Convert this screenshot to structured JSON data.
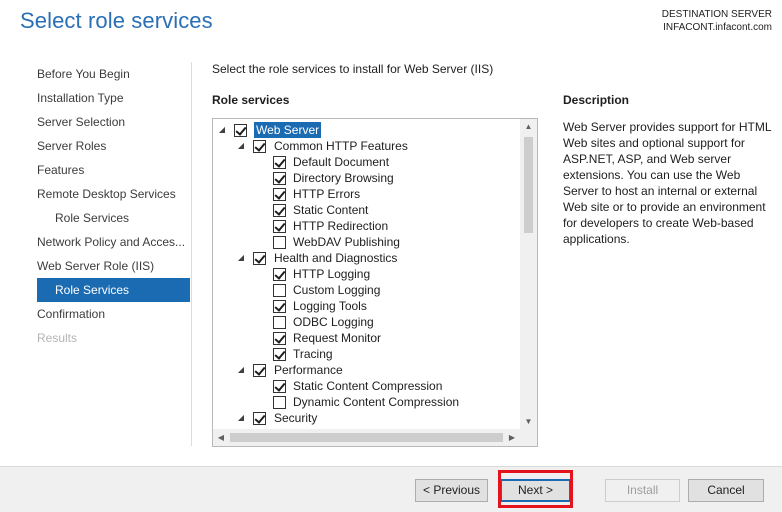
{
  "header": {
    "title": "Select role services",
    "destination_label": "DESTINATION SERVER",
    "destination_server": "INFACONT.infacont.com"
  },
  "nav": {
    "items": [
      {
        "label": "Before You Begin",
        "state": "normal",
        "indent": false
      },
      {
        "label": "Installation Type",
        "state": "normal",
        "indent": false
      },
      {
        "label": "Server Selection",
        "state": "normal",
        "indent": false
      },
      {
        "label": "Server Roles",
        "state": "normal",
        "indent": false
      },
      {
        "label": "Features",
        "state": "normal",
        "indent": false
      },
      {
        "label": "Remote Desktop Services",
        "state": "normal",
        "indent": false
      },
      {
        "label": "Role Services",
        "state": "normal",
        "indent": true
      },
      {
        "label": "Network Policy and Acces...",
        "state": "normal",
        "indent": false
      },
      {
        "label": "Web Server Role (IIS)",
        "state": "normal",
        "indent": false
      },
      {
        "label": "Role Services",
        "state": "selected",
        "indent": true
      },
      {
        "label": "Confirmation",
        "state": "normal",
        "indent": false
      },
      {
        "label": "Results",
        "state": "disabled",
        "indent": false
      }
    ]
  },
  "main": {
    "instruction": "Select the role services to install for Web Server (IIS)",
    "role_services_heading": "Role services",
    "tree": [
      {
        "label": "Web Server",
        "level": 0,
        "checked": true,
        "expander": true,
        "highlight": true
      },
      {
        "label": "Common HTTP Features",
        "level": 1,
        "checked": true,
        "expander": true
      },
      {
        "label": "Default Document",
        "level": 2,
        "checked": true
      },
      {
        "label": "Directory Browsing",
        "level": 2,
        "checked": true
      },
      {
        "label": "HTTP Errors",
        "level": 2,
        "checked": true
      },
      {
        "label": "Static Content",
        "level": 2,
        "checked": true
      },
      {
        "label": "HTTP Redirection",
        "level": 2,
        "checked": true
      },
      {
        "label": "WebDAV Publishing",
        "level": 2,
        "checked": false
      },
      {
        "label": "Health and Diagnostics",
        "level": 1,
        "checked": true,
        "expander": true
      },
      {
        "label": "HTTP Logging",
        "level": 2,
        "checked": true
      },
      {
        "label": "Custom Logging",
        "level": 2,
        "checked": false
      },
      {
        "label": "Logging Tools",
        "level": 2,
        "checked": true
      },
      {
        "label": "ODBC Logging",
        "level": 2,
        "checked": false
      },
      {
        "label": "Request Monitor",
        "level": 2,
        "checked": true
      },
      {
        "label": "Tracing",
        "level": 2,
        "checked": true
      },
      {
        "label": "Performance",
        "level": 1,
        "checked": true,
        "expander": true
      },
      {
        "label": "Static Content Compression",
        "level": 2,
        "checked": true
      },
      {
        "label": "Dynamic Content Compression",
        "level": 2,
        "checked": false
      },
      {
        "label": "Security",
        "level": 1,
        "checked": true,
        "expander": true
      }
    ],
    "description_heading": "Description",
    "description_text": "Web Server provides support for HTML Web sites and optional support for ASP.NET, ASP, and Web server extensions. You can use the Web Server to host an internal or external Web site or to provide an environment for developers to create Web-based applications."
  },
  "footer": {
    "previous_label": "< Previous",
    "next_label": "Next >",
    "install_label": "Install",
    "cancel_label": "Cancel"
  },
  "icons": {
    "expander": "triangle-expanded-icon",
    "scroll_up": "chevron-up-icon",
    "scroll_down": "chevron-down-icon",
    "scroll_left": "chevron-left-icon",
    "scroll_right": "chevron-right-icon"
  },
  "colors": {
    "title": "#2a6fb5",
    "selection": "#1a6bb2",
    "callout": "#e3141e"
  }
}
